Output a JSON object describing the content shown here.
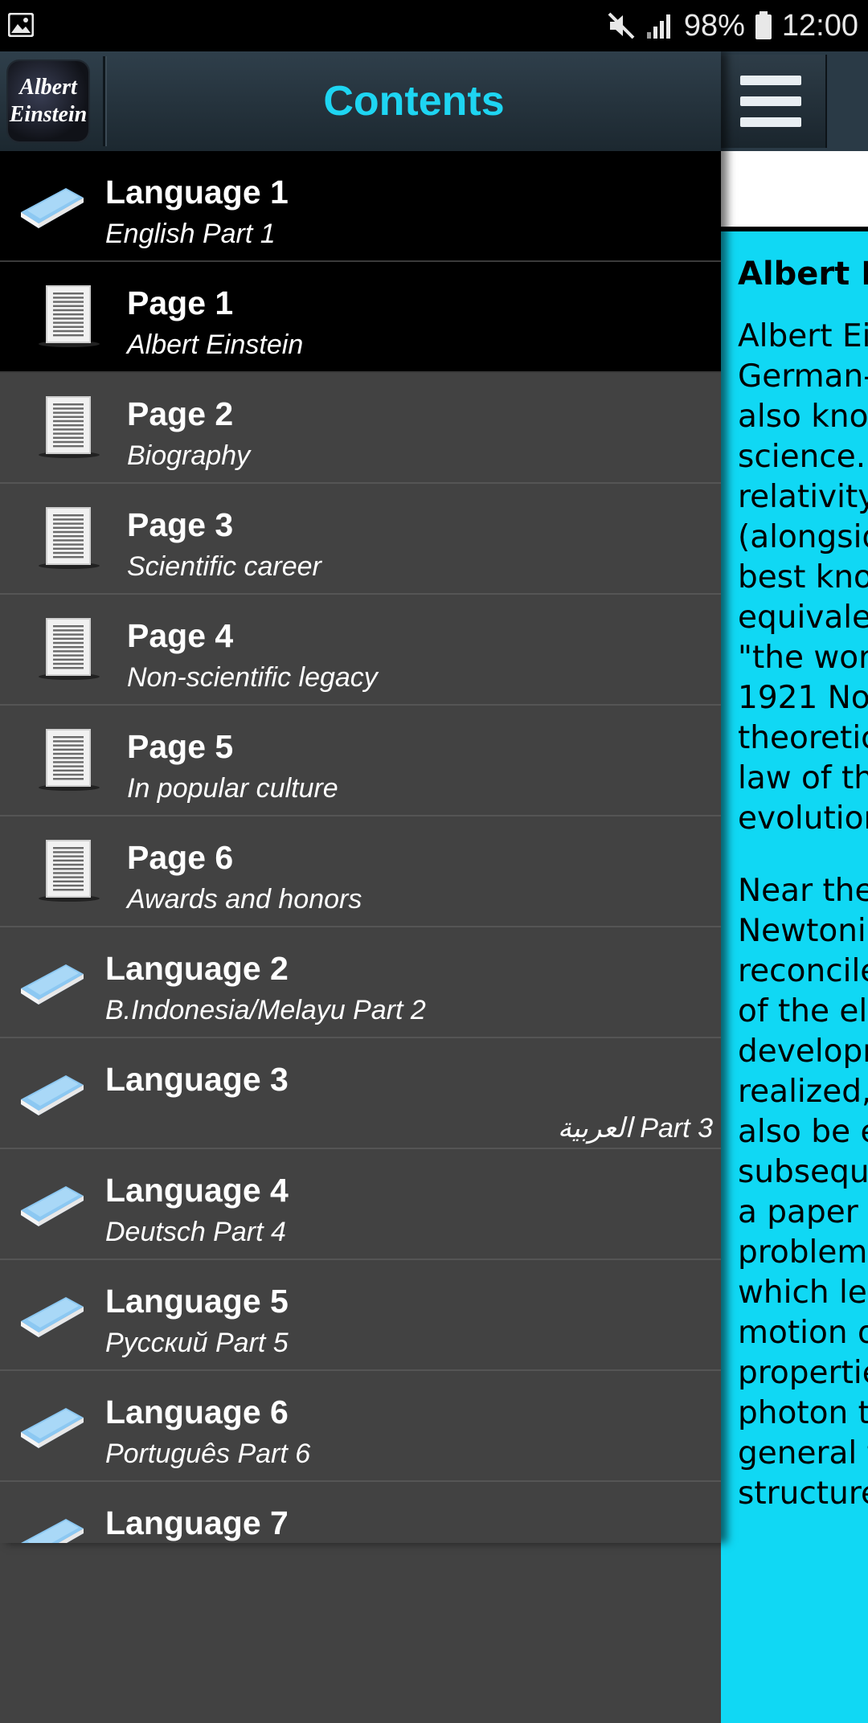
{
  "status_bar": {
    "battery": "98%",
    "time": "12:00",
    "icons": [
      "image-icon",
      "mute-icon",
      "signal-icon",
      "battery-icon"
    ]
  },
  "drawer": {
    "logo_lines": [
      "Albert",
      "Einstein"
    ],
    "title": "Contents",
    "items": [
      {
        "kind": "lang",
        "title": "Language 1",
        "subtitle": "English Part 1",
        "selected": true
      },
      {
        "kind": "page",
        "title": "Page 1",
        "subtitle": "Albert Einstein",
        "selected": true
      },
      {
        "kind": "page",
        "title": "Page 2",
        "subtitle": "Biography"
      },
      {
        "kind": "page",
        "title": "Page 3",
        "subtitle": "Scientific career"
      },
      {
        "kind": "page",
        "title": "Page 4",
        "subtitle": "Non-scientific legacy"
      },
      {
        "kind": "page",
        "title": "Page 5",
        "subtitle": "In popular culture"
      },
      {
        "kind": "page",
        "title": "Page 6",
        "subtitle": "Awards and honors"
      },
      {
        "kind": "lang",
        "title": "Language 2",
        "subtitle": "B.Indonesia/Melayu Part 2"
      },
      {
        "kind": "lang",
        "title": "Language 3",
        "subtitle": "العربية Part 3",
        "rtl": true
      },
      {
        "kind": "lang",
        "title": "Language 4",
        "subtitle": "Deutsch Part 4"
      },
      {
        "kind": "lang",
        "title": "Language 5",
        "subtitle": "Русский Part 5"
      },
      {
        "kind": "lang",
        "title": "Language 6",
        "subtitle": "Português Part 6"
      },
      {
        "kind": "lang",
        "title": "Language 7",
        "subtitle": ""
      }
    ]
  },
  "content": {
    "title": "Albert Ei",
    "paragraph1": [
      "Albert Ein",
      "German-",
      "also know",
      "science.[",
      "relativity,",
      "(alongsid",
      "best kno",
      "equivaler",
      "\"the worl",
      "1921 No",
      "theoretic",
      "law of th",
      "evolution"
    ],
    "paragraph2": [
      "Near the",
      "Newtonia",
      "reconcile",
      "of the ele",
      "developn",
      "realized,",
      "also be e",
      "subsequ",
      "a paper o",
      "problems",
      "which lec",
      "motion o",
      "propertie",
      "photon th",
      "general t",
      "structure"
    ]
  },
  "colors": {
    "accent": "#1ed5f2",
    "content_bg": "#10d8f4",
    "drawer_bg": "#424242",
    "selected_bg": "#000000"
  }
}
